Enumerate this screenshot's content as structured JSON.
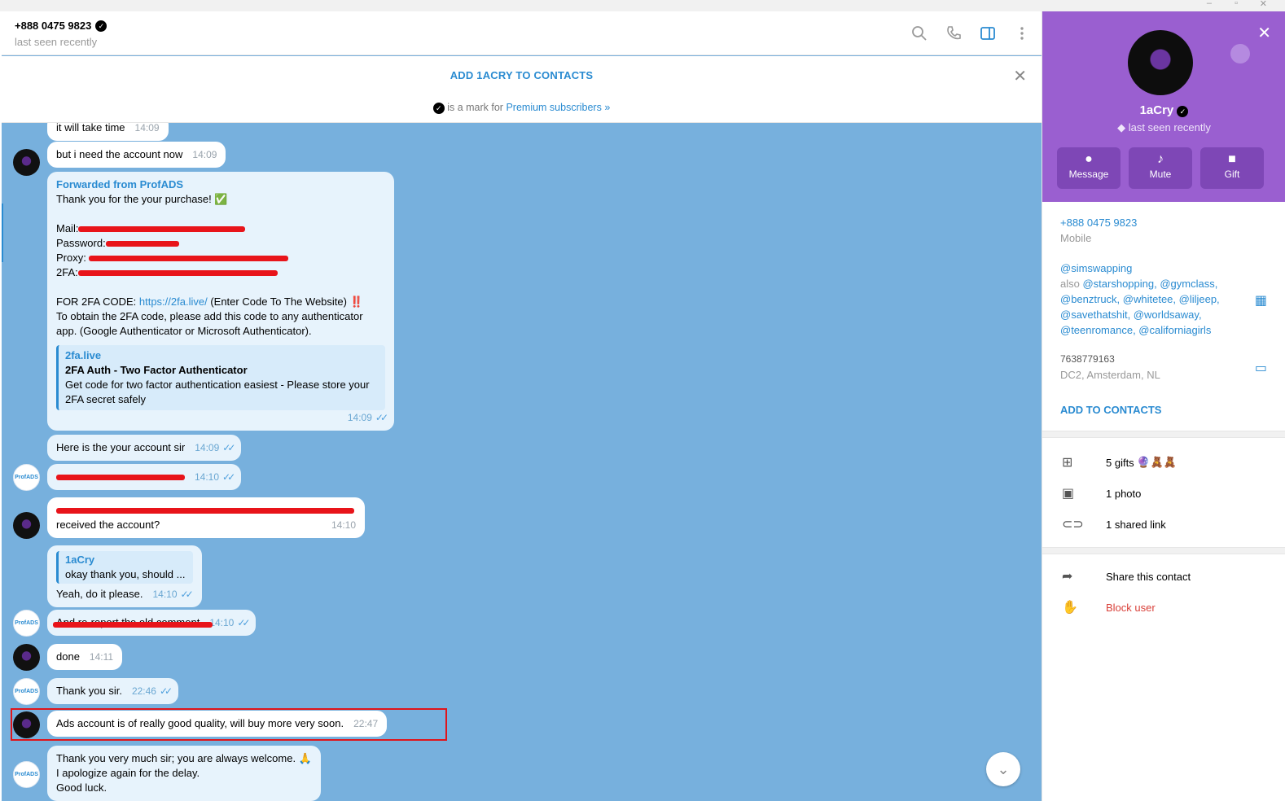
{
  "header": {
    "phone": "+888 0475 9823",
    "status": "last seen recently"
  },
  "banner": {
    "add_label": "ADD 1ACRY TO CONTACTS",
    "premium_note": "is a mark for",
    "premium_link": "Premium subscribers »"
  },
  "messages": {
    "m0_text": "it will take time",
    "m0_time": "14:09",
    "m1_text": "but i need the account now",
    "m1_time": "14:09",
    "m2_fwd_label": "Forwarded from",
    "m2_fwd_name": "ProfADS",
    "m2_line1": "Thank you for the your purchase! ✅",
    "m2_mail": "Mail:",
    "m2_password": "Password:",
    "m2_proxy": "Proxy:",
    "m2_2fa": "2FA:",
    "m2_code_label": "FOR 2FA CODE:",
    "m2_code_link": "https://2fa.live/",
    "m2_code_rest": "(Enter Code To The Website) ‼️",
    "m2_obtain": "To obtain the 2FA code, please add this code to any authenticator app. (Google Authenticator or Microsoft Authenticator).",
    "m2_preview_site": "2fa.live",
    "m2_preview_title": "2FA Auth - Two Factor Authenticator",
    "m2_preview_desc": "Get code for two factor authentication easiest - Please store your 2FA secret safely",
    "m2_time": "14:09",
    "m3_text": "Here is the your account sir",
    "m3_time": "14:09",
    "m4_time": "14:10",
    "m5_text": "received the account?",
    "m5_time": "14:10",
    "m6_reply_name": "1aCry",
    "m6_reply_text": "okay thank you, should ...",
    "m6_text": "Yeah, do it please.",
    "m6_time": "14:10",
    "m7_text": "And re-report the old comment",
    "m7_time": "14:10",
    "m8_text": "done",
    "m8_time": "14:11",
    "m9_text": "Thank you sir.",
    "m9_time": "22:46",
    "m10_text": "Ads account is of really good quality, will buy more very soon.",
    "m10_time": "22:47",
    "m11_line1": "Thank you very much sir; you are always welcome. 🙏",
    "m11_line2": "I apologize again for the delay.",
    "m11_line3": "Good luck."
  },
  "panel": {
    "name": "1aCry",
    "status": "last seen recently",
    "buttons": {
      "message": "Message",
      "mute": "Mute",
      "gift": "Gift"
    },
    "phone": "+888 0475 9823",
    "phone_label": "Mobile",
    "username": "@simswapping",
    "also_label": "also",
    "also_1": "@starshopping, @gymclass,",
    "also_2": "@benztruck, @whitetee, @liljeep,",
    "also_3": "@savethatshit, @worldsaway,",
    "also_4": "@teenromance, @californiagirls",
    "id": "7638779163",
    "dc": "DC2, Amsterdam, NL",
    "add_contacts": "ADD TO CONTACTS",
    "gifts": "5 gifts",
    "gift_icons": "🔮🧸🧸",
    "photos": "1 photo",
    "links": "1 shared link",
    "share": "Share this contact",
    "block": "Block user"
  },
  "colors": {
    "accent": "#2a8bd1",
    "chat_bg": "#77b0dd",
    "panel_header": "#9a5fd0",
    "redaction": "#e8141a",
    "danger": "#d9413a"
  }
}
